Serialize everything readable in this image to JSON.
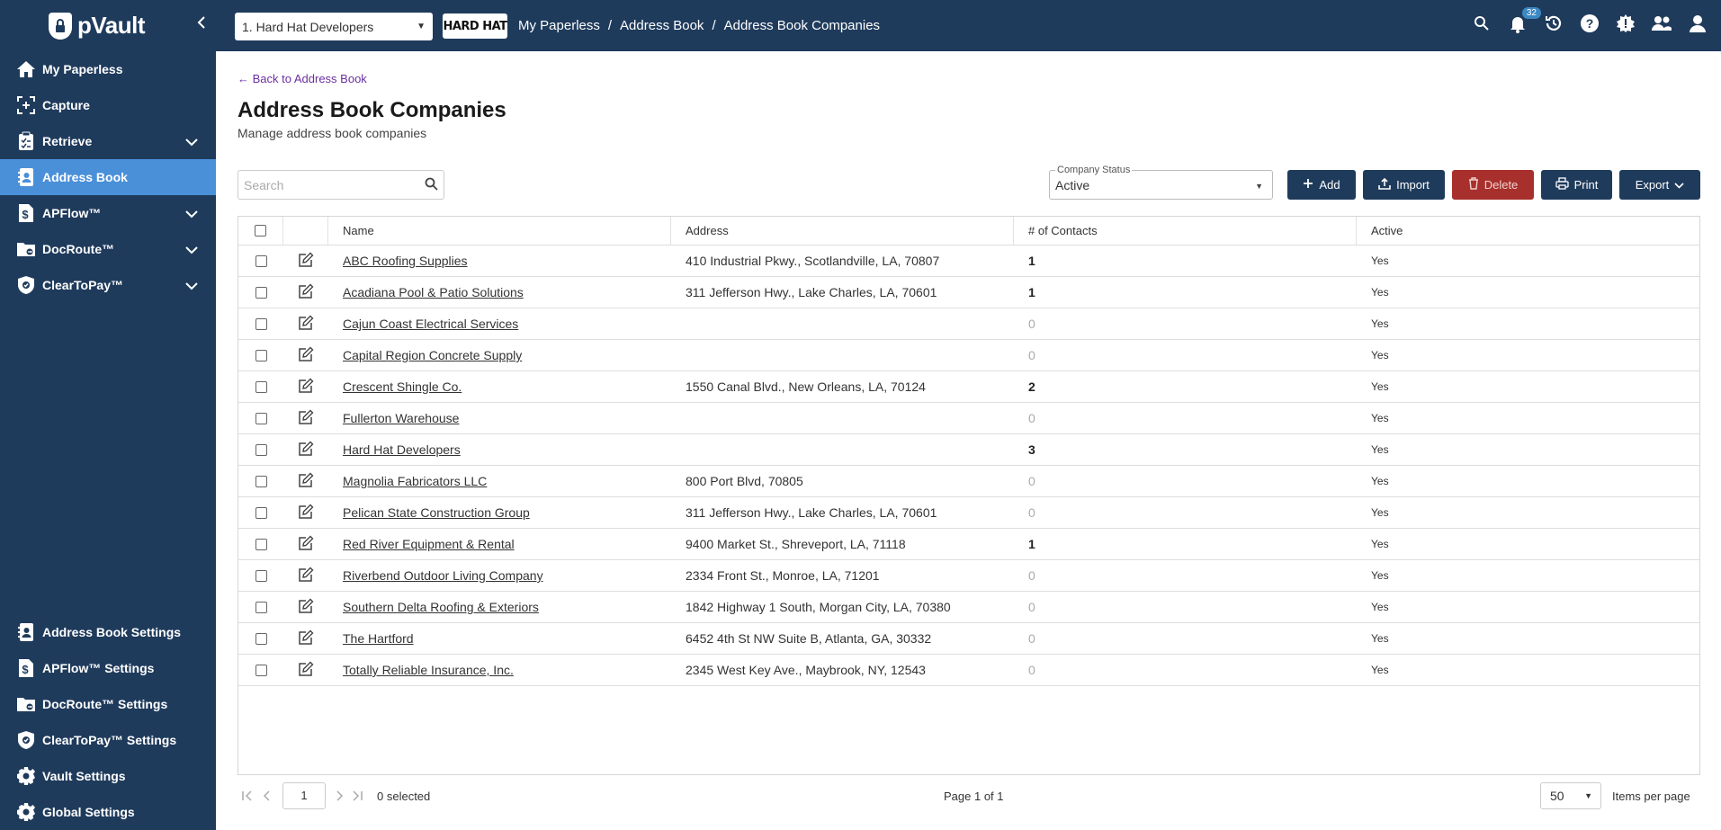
{
  "app": {
    "logo_text": "pVault",
    "vault_selector": "1. Hard Hat Developers",
    "company_logo_text": "HARD HAT",
    "notification_count": "32"
  },
  "breadcrumb": [
    "My Paperless",
    "/",
    "Address Book",
    "/",
    "Address Book Companies"
  ],
  "sidebar": {
    "items": [
      {
        "label": "My Paperless",
        "icon": "home-icon"
      },
      {
        "label": "Capture",
        "icon": "capture-icon"
      },
      {
        "label": "Retrieve",
        "icon": "clipboard-icon"
      },
      {
        "label": "Address Book",
        "icon": "address-book-icon"
      },
      {
        "label": "APFlow™",
        "icon": "dollar-doc-icon"
      },
      {
        "label": "DocRoute™",
        "icon": "folder-route-icon"
      },
      {
        "label": "ClearToPay™",
        "icon": "shield-check-icon"
      }
    ],
    "bottom_items": [
      {
        "label": "Address Book Settings",
        "icon": "address-book-icon"
      },
      {
        "label": "APFlow™ Settings",
        "icon": "dollar-doc-icon"
      },
      {
        "label": "DocRoute™ Settings",
        "icon": "folder-route-icon"
      },
      {
        "label": "ClearToPay™ Settings",
        "icon": "shield-check-icon"
      },
      {
        "label": "Vault Settings",
        "icon": "gear-icon"
      },
      {
        "label": "Global Settings",
        "icon": "gear-icon"
      }
    ]
  },
  "page": {
    "back_link": "← Back to Address Book",
    "title": "Address Book Companies",
    "subtitle": "Manage address book companies"
  },
  "toolbar": {
    "search_placeholder": "Search",
    "status_label": "Company Status",
    "status_value": "Active",
    "add_label": "Add",
    "import_label": "Import",
    "delete_label": "Delete",
    "print_label": "Print",
    "export_label": "Export"
  },
  "table": {
    "columns": [
      "Name",
      "Address",
      "# of Contacts",
      "Active"
    ],
    "rows": [
      {
        "name": "ABC Roofing Supplies",
        "address": "410 Industrial Pkwy., Scotlandville, LA, 70807",
        "contacts": "1",
        "active": "Yes"
      },
      {
        "name": "Acadiana Pool & Patio Solutions",
        "address": "311 Jefferson Hwy., Lake Charles, LA, 70601",
        "contacts": "1",
        "active": "Yes"
      },
      {
        "name": "Cajun Coast Electrical Services",
        "address": "",
        "contacts": "0",
        "active": "Yes"
      },
      {
        "name": "Capital Region Concrete Supply",
        "address": "",
        "contacts": "0",
        "active": "Yes"
      },
      {
        "name": "Crescent Shingle Co.",
        "address": "1550 Canal Blvd., New Orleans, LA, 70124",
        "contacts": "2",
        "active": "Yes"
      },
      {
        "name": "Fullerton Warehouse",
        "address": "",
        "contacts": "0",
        "active": "Yes"
      },
      {
        "name": "Hard Hat Developers",
        "address": "",
        "contacts": "3",
        "active": "Yes"
      },
      {
        "name": "Magnolia Fabricators LLC",
        "address": "800 Port Blvd, 70805",
        "contacts": "0",
        "active": "Yes"
      },
      {
        "name": "Pelican State Construction Group",
        "address": "311 Jefferson Hwy., Lake Charles, LA, 70601",
        "contacts": "0",
        "active": "Yes"
      },
      {
        "name": "Red River Equipment & Rental",
        "address": "9400 Market St., Shreveport, LA, 71118",
        "contacts": "1",
        "active": "Yes"
      },
      {
        "name": "Riverbend Outdoor Living Company",
        "address": "2334 Front St., Monroe, LA, 71201",
        "contacts": "0",
        "active": "Yes"
      },
      {
        "name": "Southern Delta Roofing & Exteriors",
        "address": "1842 Highway 1 South, Morgan City, LA, 70380",
        "contacts": "0",
        "active": "Yes"
      },
      {
        "name": "The Hartford",
        "address": "6452 4th St NW Suite B, Atlanta, GA, 30332",
        "contacts": "0",
        "active": "Yes"
      },
      {
        "name": "Totally Reliable Insurance, Inc.",
        "address": "2345 West Key Ave., Maybrook, NY, 12543",
        "contacts": "0",
        "active": "Yes"
      }
    ]
  },
  "pager": {
    "current_page": "1",
    "selected_text": "0 selected",
    "page_text": "Page 1 of 1",
    "page_size": "50",
    "items_per_page_label": "Items per page"
  }
}
